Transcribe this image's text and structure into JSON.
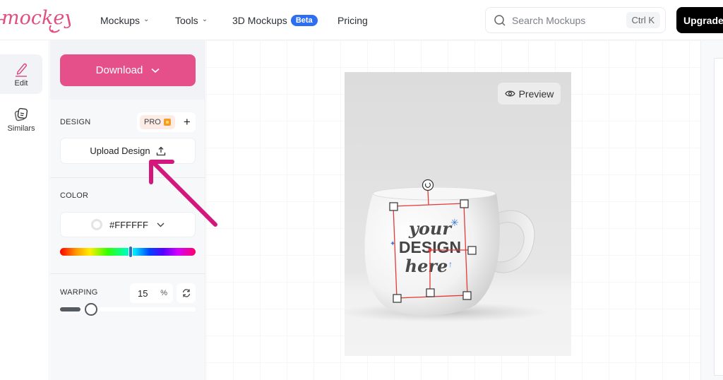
{
  "header": {
    "logo_text": "mockey",
    "nav": [
      {
        "label": "Mockups",
        "has_dropdown": true
      },
      {
        "label": "Tools",
        "has_dropdown": true
      },
      {
        "label": "3D Mockups",
        "badge": "Beta",
        "has_dropdown": false
      },
      {
        "label": "Pricing",
        "has_dropdown": false
      }
    ],
    "search": {
      "placeholder": "Search Mockups",
      "shortcut": "Ctrl K",
      "icon": "search-icon"
    },
    "upgrade_label": "Upgrade"
  },
  "rail": {
    "items": [
      {
        "label": "Edit",
        "icon": "pencil-icon",
        "active": true
      },
      {
        "label": "Similars",
        "icon": "similars-stack-icon",
        "active": false
      }
    ]
  },
  "panel": {
    "download_label": "Download",
    "design": {
      "label": "DESIGN",
      "pro_badge": "PRO",
      "add_icon": "plus-icon",
      "upload_label": "Upload Design",
      "upload_icon": "upload-icon"
    },
    "color": {
      "label": "COLOR",
      "value": "#FFFFFF",
      "hue_position": 0.52
    },
    "warping": {
      "label": "WARPING",
      "value": "15",
      "unit": "%",
      "slider_fraction": 0.15,
      "reset_icon": "refresh-icon"
    }
  },
  "canvas": {
    "preview_label": "Preview",
    "design_text": {
      "line1": "your",
      "line2": "DESIGN",
      "line3": "here"
    }
  },
  "colors": {
    "brand_pink": "#E5508B",
    "beta_blue": "#2E6FF2",
    "upgrade_black": "#000000",
    "annotation_arrow": "#D4177C",
    "selection_red": "#E53935"
  }
}
